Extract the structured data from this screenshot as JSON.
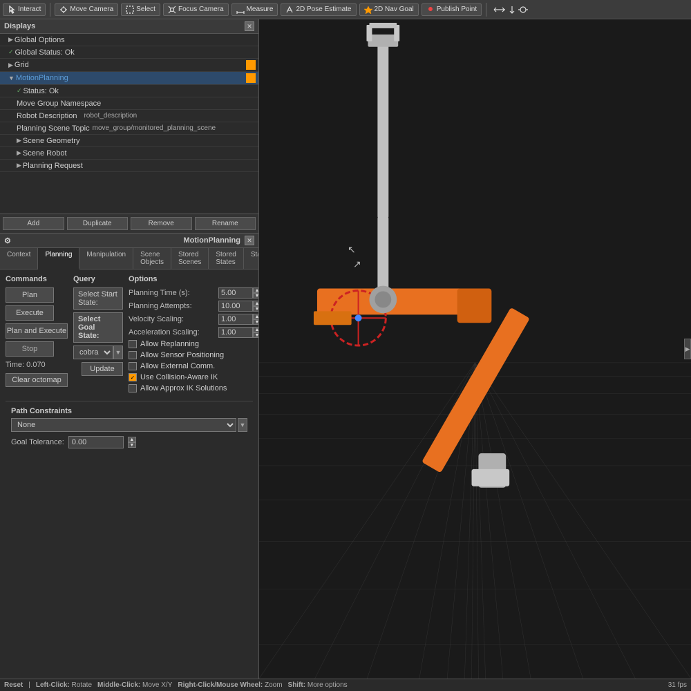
{
  "toolbar": {
    "buttons": [
      {
        "id": "interact",
        "label": "Interact",
        "icon": "cursor"
      },
      {
        "id": "move-camera",
        "label": "Move Camera",
        "icon": "camera"
      },
      {
        "id": "select",
        "label": "Select",
        "icon": "cursor"
      },
      {
        "id": "focus-camera",
        "label": "Focus Camera",
        "icon": "focus"
      },
      {
        "id": "measure",
        "label": "Measure",
        "icon": "ruler"
      },
      {
        "id": "2d-pose-estimate",
        "label": "2D Pose Estimate",
        "icon": "pose"
      },
      {
        "id": "2d-nav-goal",
        "label": "2D Nav Goal",
        "icon": "nav"
      },
      {
        "id": "publish-point",
        "label": "Publish Point",
        "icon": "point"
      }
    ]
  },
  "displays": {
    "title": "Displays",
    "items": [
      {
        "id": "global-options",
        "label": "Global Options",
        "indent": 1,
        "arrow": "▶",
        "has_checkbox": false
      },
      {
        "id": "global-status",
        "label": "Global Status: Ok",
        "indent": 1,
        "arrow": "✓",
        "has_checkbox": true,
        "checked": true
      },
      {
        "id": "grid",
        "label": "Grid",
        "indent": 1,
        "arrow": "▶",
        "has_checkbox": true,
        "checked": false,
        "has_color": true
      },
      {
        "id": "motion-planning",
        "label": "MotionPlanning",
        "indent": 1,
        "arrow": "▼",
        "has_checkbox": true,
        "checked": false,
        "has_color": true,
        "is_blue": true
      },
      {
        "id": "status-ok",
        "label": "Status: Ok",
        "indent": 2,
        "arrow": "✓",
        "has_checkbox": false
      },
      {
        "id": "move-group-ns",
        "label": "Move Group Namespace",
        "indent": 2,
        "has_checkbox": false,
        "value": ""
      },
      {
        "id": "robot-description",
        "label": "Robot Description",
        "indent": 2,
        "has_checkbox": false,
        "value": "robot_description"
      },
      {
        "id": "planning-scene-topic",
        "label": "Planning Scene Topic",
        "indent": 2,
        "has_checkbox": false,
        "value": "move_group/monitored_planning_scene"
      },
      {
        "id": "scene-geometry",
        "label": "Scene Geometry",
        "indent": 2,
        "arrow": "▶",
        "has_checkbox": false
      },
      {
        "id": "scene-robot",
        "label": "Scene Robot",
        "indent": 2,
        "arrow": "▶",
        "has_checkbox": false
      },
      {
        "id": "planning-request",
        "label": "Planning Request",
        "indent": 2,
        "arrow": "▶",
        "has_checkbox": false
      }
    ],
    "buttons": {
      "add": "Add",
      "duplicate": "Duplicate",
      "remove": "Remove",
      "rename": "Rename"
    }
  },
  "motion_planning": {
    "title": "MotionPlanning",
    "tabs": [
      "Context",
      "Planning",
      "Manipulation",
      "Scene Objects",
      "Stored Scenes",
      "Stored States",
      "Status"
    ],
    "active_tab": "Planning",
    "commands": {
      "title": "Commands",
      "plan_label": "Plan",
      "execute_label": "Execute",
      "plan_execute_label": "Plan and Execute",
      "stop_label": "Stop"
    },
    "query": {
      "title": "Query",
      "start_state_label": "Select Start State:",
      "goal_state_label": "Select Goal State:",
      "dropdown_value": "cobra",
      "update_label": "Update"
    },
    "options": {
      "title": "Options",
      "planning_time_label": "Planning Time (s):",
      "planning_time_value": "5.00",
      "planning_attempts_label": "Planning Attempts:",
      "planning_attempts_value": "10.00",
      "velocity_scaling_label": "Velocity Scaling:",
      "velocity_scaling_value": "1.00",
      "acceleration_scaling_label": "Acceleration Scaling:",
      "acceleration_scaling_value": "1.00",
      "checkboxes": [
        {
          "id": "allow-replanning",
          "label": "Allow Replanning",
          "checked": false
        },
        {
          "id": "allow-sensor-positioning",
          "label": "Allow Sensor Positioning",
          "checked": false
        },
        {
          "id": "allow-external-comm",
          "label": "Allow External Comm.",
          "checked": false
        },
        {
          "id": "use-collision-aware-ik",
          "label": "Use Collision-Aware IK",
          "checked": true
        },
        {
          "id": "allow-approx-ik",
          "label": "Allow Approx IK Solutions",
          "checked": false
        }
      ]
    },
    "time_label": "Time: 0.070",
    "clear_octomap_label": "Clear octomap",
    "path_constraints": {
      "title": "Path Constraints",
      "value": "None",
      "goal_tolerance_label": "Goal Tolerance:",
      "goal_tolerance_value": "0.00"
    }
  },
  "statusbar": {
    "reset_label": "Reset",
    "left_click": "Left-Click:",
    "left_action": "Rotate",
    "middle_click": "Middle-Click:",
    "middle_action": "Move X/Y",
    "right_click": "Right-Click/Mouse Wheel:",
    "right_action": "Zoom",
    "shift": "Shift:",
    "shift_action": "More options",
    "fps": "31 fps"
  }
}
